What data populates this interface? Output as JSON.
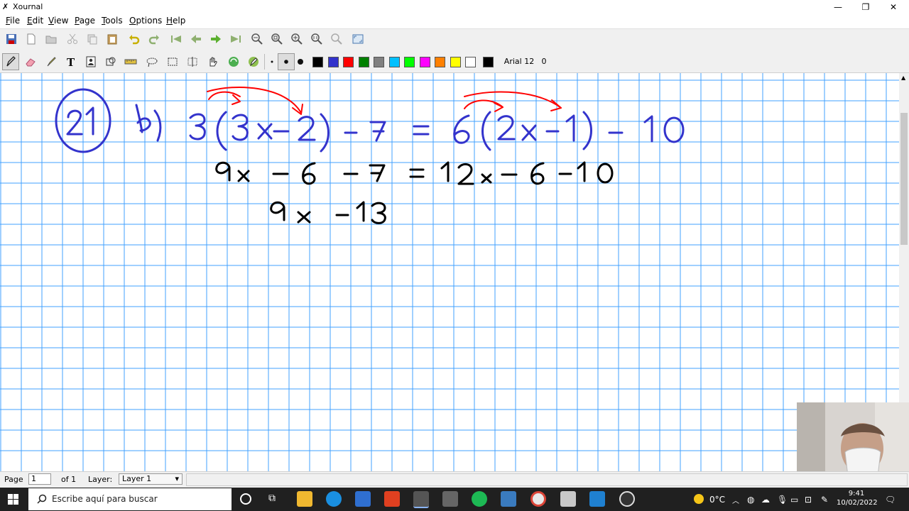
{
  "window": {
    "title": "Xournal"
  },
  "menu": [
    {
      "label": "File",
      "accel": "F",
      "rest": "ile"
    },
    {
      "label": "Edit",
      "accel": "E",
      "rest": "dit"
    },
    {
      "label": "View",
      "accel": "V",
      "rest": "iew"
    },
    {
      "label": "Page",
      "accel": "P",
      "rest": "age"
    },
    {
      "label": "Tools",
      "accel": "T",
      "rest": "ools"
    },
    {
      "label": "Options",
      "accel": "O",
      "rest": "ptions"
    },
    {
      "label": "Help",
      "accel": "H",
      "rest": "elp"
    }
  ],
  "toolbar": {
    "font_button": "Arial 12",
    "font_size_value": "0",
    "colors": [
      "#000000",
      "#3333cc",
      "#ff0000",
      "#008000",
      "#808080",
      "#00c0ff",
      "#00ff00",
      "#ff00ff",
      "#ff8000",
      "#ffff00",
      "#ffffff"
    ],
    "current_color": "#000000"
  },
  "canvas": {
    "grid_color": "#40a0ff",
    "ink_blue": "#3333cc",
    "ink_red": "#ff0000",
    "ink_black": "#000000",
    "line1": "b) 3(3x-2) - 7 = 6(2x-1) - 10",
    "problem_number": "21",
    "part_label": "b)",
    "line2": "9x - 6 - 7 = 12x - 6 - 10",
    "line3": "9x - 13"
  },
  "status": {
    "page_label": "Page",
    "page_value": "1",
    "page_of": "of 1",
    "layer_label": "Layer:",
    "layer_value": "Layer 1"
  },
  "taskbar": {
    "search_placeholder": "Escribe aquí para buscar",
    "temperature": "0°C",
    "time": "9:41",
    "date": "10/02/2022"
  }
}
